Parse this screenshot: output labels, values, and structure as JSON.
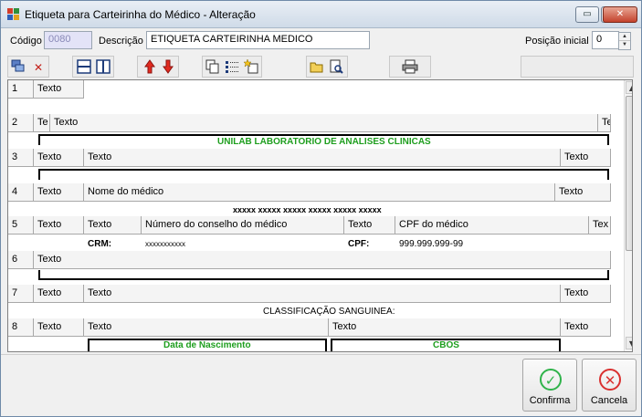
{
  "window": {
    "title": "Etiqueta para Carteirinha do Médico - Alteração",
    "minimize": "▭",
    "maximize": "▢",
    "close": "✕"
  },
  "form": {
    "codigo_label": "Código",
    "codigo_value": "0080",
    "descricao_label": "Descrição",
    "descricao_value": "ETIQUETA CARTEIRINHA MEDICO",
    "posicao_label": "Posição inicial",
    "posicao_value": "0",
    "spin_up": "▲",
    "spin_down": "▼"
  },
  "toolbar": {
    "icons": [
      "add-record-icon",
      "delete-icon",
      "split-horizontal-icon",
      "split-vertical-icon",
      "move-up-icon",
      "move-down-icon",
      "copy-icon",
      "list-fields-icon",
      "new-field-icon",
      "open-folder-icon",
      "preview-icon",
      "print-icon"
    ],
    "glyphs": {
      "delete": "✕",
      "up": "🡑",
      "down": "🡓"
    }
  },
  "grid": {
    "rows": [
      {
        "num": "1",
        "cells": [
          "Texto"
        ]
      },
      {
        "num": "2",
        "cells": [
          "Te",
          "Texto",
          "Te"
        ],
        "preview": [
          "UNILAB LABORATORIO DE ANALISES CLINICAS"
        ]
      },
      {
        "num": "3",
        "cells": [
          "Texto",
          "Texto",
          "Texto"
        ]
      },
      {
        "num": "4",
        "cells": [
          "Texto",
          "Nome do médico",
          "Texto"
        ],
        "preview": [
          "xxxxx xxxxx xxxxx xxxxx xxxxx xxxxx"
        ]
      },
      {
        "num": "5",
        "cells": [
          "Texto",
          "Texto",
          "Número do conselho do médico",
          "Texto",
          "CPF do médico",
          "Tex"
        ],
        "preview": [
          "CRM:",
          "xxxxxxxxxxx",
          "CPF:",
          "999.999.999-99"
        ]
      },
      {
        "num": "6",
        "cells": [
          "Texto"
        ]
      },
      {
        "num": "7",
        "cells": [
          "Texto",
          "Texto",
          "Texto"
        ],
        "preview": [
          "CLASSIFICAÇÃO SANGUINEA:"
        ]
      },
      {
        "num": "8",
        "cells": [
          "Texto",
          "Texto",
          "Texto",
          "Texto"
        ],
        "preview": [
          "Data de Nascimento",
          "CBOS"
        ]
      }
    ],
    "scroll_up": "▲",
    "scroll_down": "▼"
  },
  "buttons": {
    "confirma": "Confirma",
    "cancela": "Cancela",
    "confirma_glyph": "✓",
    "cancela_glyph": "✕"
  },
  "colors": {
    "preview_green": "#1e9e1e",
    "confirm_green": "#2fb34a",
    "cancel_red": "#d9302f",
    "field_disabled": "#e3e3f7"
  }
}
